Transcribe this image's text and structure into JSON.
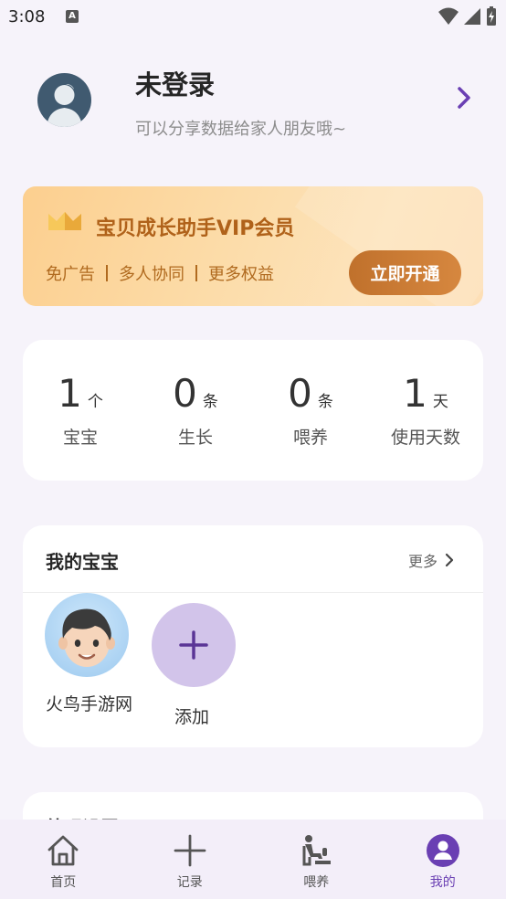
{
  "status_bar": {
    "time": "3:08",
    "notification_letter": "A"
  },
  "profile": {
    "name": "未登录",
    "subtitle": "可以分享数据给家人朋友哦~"
  },
  "vip": {
    "title": "宝贝成长助手VIP会员",
    "perks": [
      "免广告",
      "多人协同",
      "更多权益"
    ],
    "button": "立即开通"
  },
  "stats": [
    {
      "value": "1",
      "unit": "个",
      "label": "宝宝"
    },
    {
      "value": "0",
      "unit": "条",
      "label": "生长"
    },
    {
      "value": "0",
      "unit": "条",
      "label": "喂养"
    },
    {
      "value": "1",
      "unit": "天",
      "label": "使用天数"
    }
  ],
  "babies": {
    "title": "我的宝宝",
    "more": "更多",
    "items": [
      {
        "name": "火鸟手游网"
      }
    ],
    "add_label": "添加"
  },
  "appearance": {
    "title": "外观设置"
  },
  "nav": [
    {
      "label": "首页",
      "icon": "home-icon"
    },
    {
      "label": "记录",
      "icon": "plus-icon"
    },
    {
      "label": "喂养",
      "icon": "feeding-icon"
    },
    {
      "label": "我的",
      "icon": "profile-icon"
    }
  ],
  "colors": {
    "accent": "#6a3fb3",
    "vip_text": "#b0621a",
    "vip_button": "#c0712c"
  }
}
